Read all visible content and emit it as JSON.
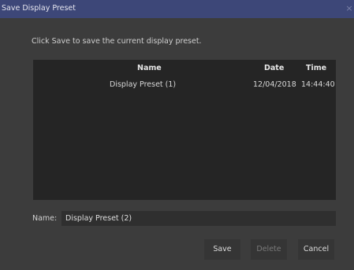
{
  "window": {
    "title": "Save Display Preset",
    "close_glyph": "×"
  },
  "instruction": "Click Save to save the current display preset.",
  "table": {
    "columns": [
      "Name",
      "Date",
      "Time"
    ],
    "rows": [
      {
        "name": "Display Preset (1)",
        "date": "12/04/2018",
        "time": "14:44:40"
      }
    ]
  },
  "name_field": {
    "label": "Name:",
    "value": "Display Preset (2)"
  },
  "buttons": {
    "save": "Save",
    "delete": "Delete",
    "cancel": "Cancel"
  }
}
